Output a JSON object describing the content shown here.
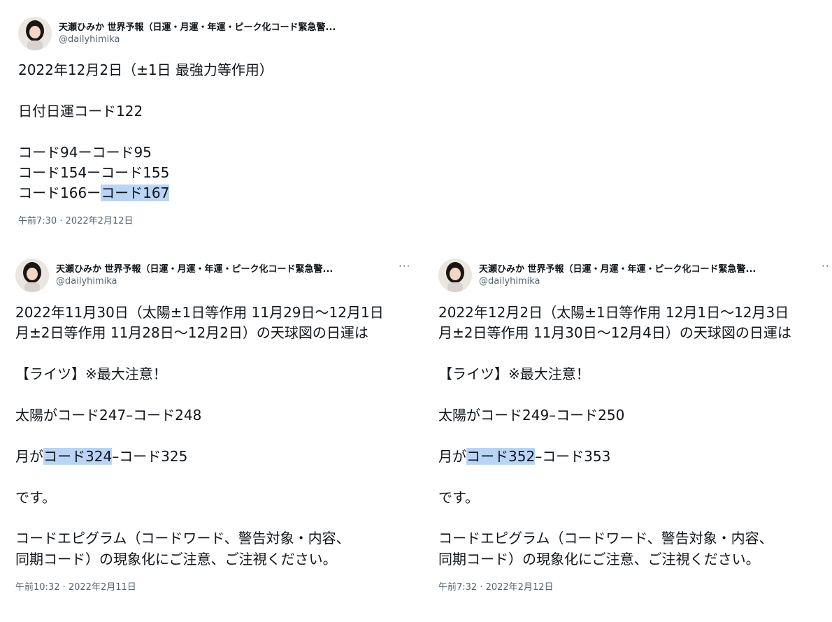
{
  "author": {
    "name": "天瀬ひみか 世界予報（日運・月運・年運・ピーク化コード緊急警...",
    "handle": "@dailyhimika"
  },
  "tweets": [
    {
      "date_line": "2022年12月2日（±1日 最強力等作用）",
      "code_line": "日付日運コード122",
      "pair1": "コード94ーコード95",
      "pair2": "コード154ーコード155",
      "pair3_prefix": "コード166ー",
      "pair3_highlight": "コード167",
      "timestamp": "午前7:30 · 2022年2月12日"
    },
    {
      "line1": "2022年11月30日（太陽±1日等作用 11月29日〜12月1日",
      "line2": "月±2日等作用 11月28日〜12月2日）の天球図の日運は",
      "warning": "【ライツ】※最大注意！",
      "sun_line": "太陽がコード247–コード248",
      "moon_prefix": "月が",
      "moon_highlight": "コード324",
      "moon_suffix": "–コード325",
      "desu": "です。",
      "note_line1": "コードエピグラム（コードワード、警告対象・内容、",
      "note_line2": "同期コード）の現象化にご注意、ご注視ください。",
      "timestamp": "午前10:32 · 2022年2月11日",
      "more_label": "···"
    },
    {
      "line1": "2022年12月2日（太陽±1日等作用 12月1日〜12月3日",
      "line2": "月±2日等作用 11月30日〜12月4日）の天球図の日運は",
      "warning": "【ライツ】※最大注意！",
      "sun_line": "太陽がコード249–コード250",
      "moon_prefix": "月が",
      "moon_highlight": "コード352",
      "moon_suffix": "–コード353",
      "desu": "です。",
      "note_line1": "コードエピグラム（コードワード、警告対象・内容、",
      "note_line2": "同期コード）の現象化にご注意、ご注視ください。",
      "timestamp": "午前7:32 · 2022年2月12日",
      "more_label": "··"
    }
  ],
  "colors": {
    "highlight": "#b9d4f5",
    "secondary_text": "#536471",
    "text": "#0f1419"
  },
  "icons": {
    "avatar": "avatar-photo",
    "more": "more-options-icon"
  }
}
